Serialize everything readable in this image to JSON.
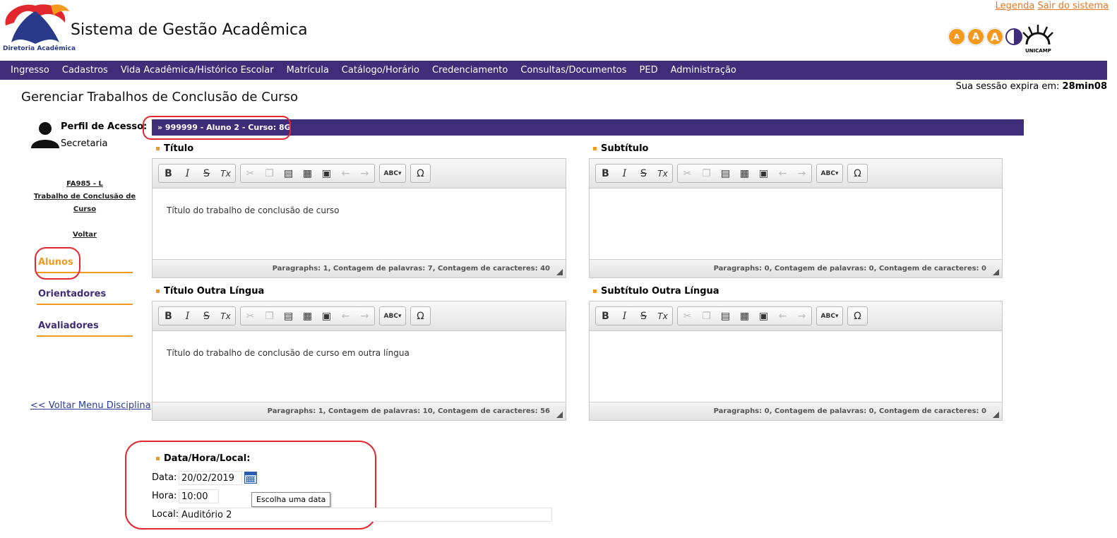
{
  "header": {
    "logo_caption": "Diretoria Acadêmica",
    "system_title": "Sistema de Gestão Acadêmica",
    "links": [
      "Legenda",
      "Sair do sistema"
    ],
    "font_size_buttons": [
      "A",
      "A",
      "A"
    ],
    "unicamp_label": "UNICAMP"
  },
  "nav": {
    "items": [
      "Ingresso",
      "Cadastros",
      "Vida Acadêmica/Histórico Escolar",
      "Matrícula",
      "Catálogo/Horário",
      "Credenciamento",
      "Consultas/Documentos",
      "PED",
      "Administração"
    ]
  },
  "page": {
    "title": "Gerenciar Trabalhos de Conclusão de Curso",
    "session_label": "Sua sessão expira em:",
    "session_time": "28min08"
  },
  "profile": {
    "label": "Perfil de Acesso:",
    "value": "Secretaria",
    "student_bar": "»  999999 - Aluno 2 - Curso: 8G"
  },
  "sidebar": {
    "course_code": "FA985 - L",
    "course_name": "Trabalho de Conclusão de Curso",
    "voltar": "Voltar",
    "items": [
      {
        "label": "Alunos",
        "active": true
      },
      {
        "label": "Orientadores",
        "active": false
      },
      {
        "label": "Avaliadores",
        "active": false
      }
    ],
    "back_menu": "<< Voltar Menu Disciplina"
  },
  "editors": {
    "titulo": {
      "label": "Título",
      "content": "Título do trabalho de conclusão de curso",
      "status": "Paragraphs: 1, Contagem de palavras: 7, Contagem de caracteres: 40"
    },
    "subtitulo": {
      "label": "Subtítulo",
      "content": "",
      "status": "Paragraphs: 0, Contagem de palavras: 0, Contagem de caracteres: 0"
    },
    "titulo_outra": {
      "label": "Título Outra Língua",
      "content": "Título do trabalho de conclusão de curso em outra língua",
      "status": "Paragraphs: 1, Contagem de palavras: 10, Contagem de caracteres: 56"
    },
    "subtitulo_outra": {
      "label": "Subtítulo Outra Língua",
      "content": "",
      "status": "Paragraphs: 0, Contagem de palavras: 0, Contagem de caracteres: 0"
    }
  },
  "toolbar": {
    "bold": "B",
    "italic": "I",
    "strike": "S",
    "clear_format": "Tx",
    "spellcheck": "ABC▾",
    "special_char": "Ω"
  },
  "schedule": {
    "section_label": "Data/Hora/Local:",
    "data_label": "Data:",
    "data_value": "20/02/2019",
    "hora_label": "Hora:",
    "hora_value": "10:00",
    "local_label": "Local:",
    "local_value": "Auditório 2",
    "tooltip": "Escolha uma data"
  },
  "colors": {
    "nav_purple": "#3f2d7a",
    "accent_orange": "#f39a1e",
    "highlight_red": "#e0282e"
  }
}
